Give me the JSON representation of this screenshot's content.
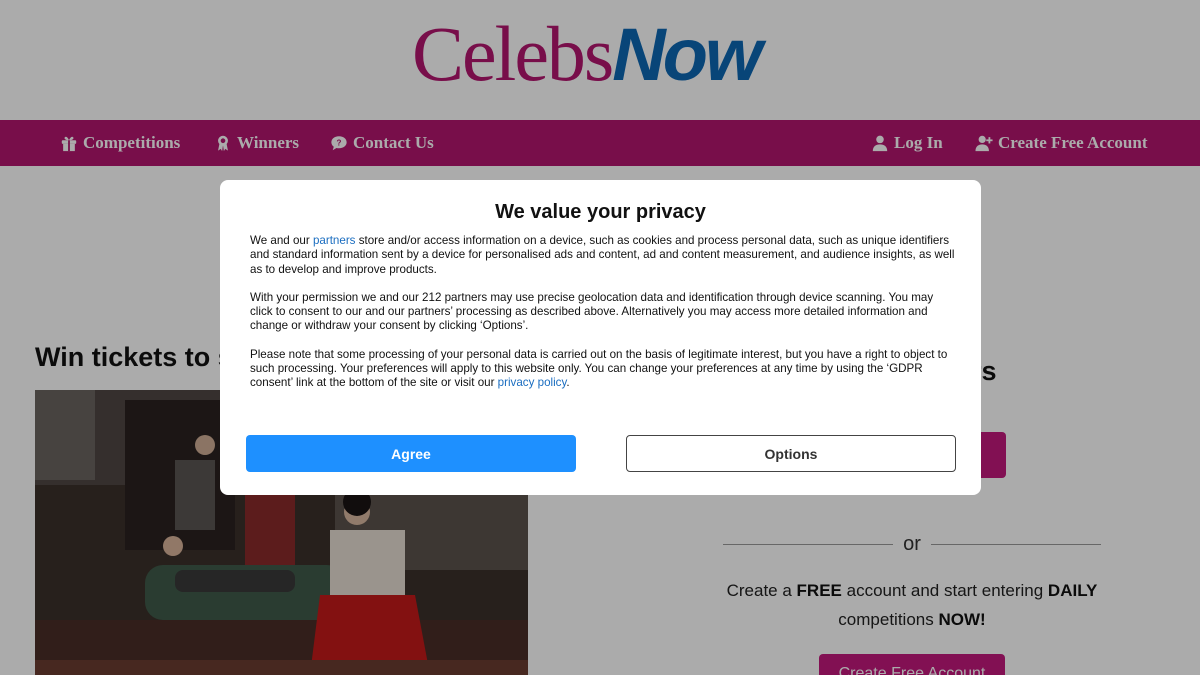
{
  "site": {
    "logo_part1": "Celebs",
    "logo_part2": "Now",
    "brand_color": "#b3156f",
    "logo_accent_color": "#0d67b3"
  },
  "nav": {
    "left": [
      {
        "label": "Competitions",
        "icon": "gift-icon"
      },
      {
        "label": "Winners",
        "icon": "award-icon"
      },
      {
        "label": "Contact Us",
        "icon": "chat-icon"
      }
    ],
    "right": [
      {
        "label": "Log In",
        "icon": "user-icon"
      },
      {
        "label": "Create Free Account",
        "icon": "user-plus-icon"
      }
    ]
  },
  "main": {
    "competition_title": "Win tickets to s",
    "winners_heading_fragment": "ers",
    "divider_text": "or",
    "create_prefix": "Create a ",
    "create_free": "FREE",
    "create_middle": " account and start entering ",
    "create_daily": "DAILY",
    "create_line2": "competitions ",
    "create_now": "NOW!",
    "create_button": "Create Free Account"
  },
  "consent": {
    "title": "We value your privacy",
    "p1_before_link": "We and our ",
    "p1_link": "partners",
    "p1_after_link": " store and/or access information on a device, such as cookies and process personal data, such as unique identifiers and standard information sent by a device for personalised ads and content, ad and content measurement, and audience insights, as well as to develop and improve products.",
    "p2": "With your permission we and our 212 partners may use precise geolocation data and identification through device scanning. You may click to consent to our and our partners’ processing as described above. Alternatively you may access more detailed information and change or withdraw your consent by clicking ‘Options’.",
    "p3_before_link": "Please note that some processing of your personal data is carried out on the basis of legitimate interest, but you have a right to object to such processing. Your preferences will apply to this website only. You can change your preferences at any time by using the ‘GDPR consent’ link at the bottom of the site or visit our ",
    "p3_link": "privacy policy",
    "p3_after_link": ".",
    "agree_label": "Agree",
    "options_label": "Options",
    "agree_color": "#1e90ff"
  }
}
